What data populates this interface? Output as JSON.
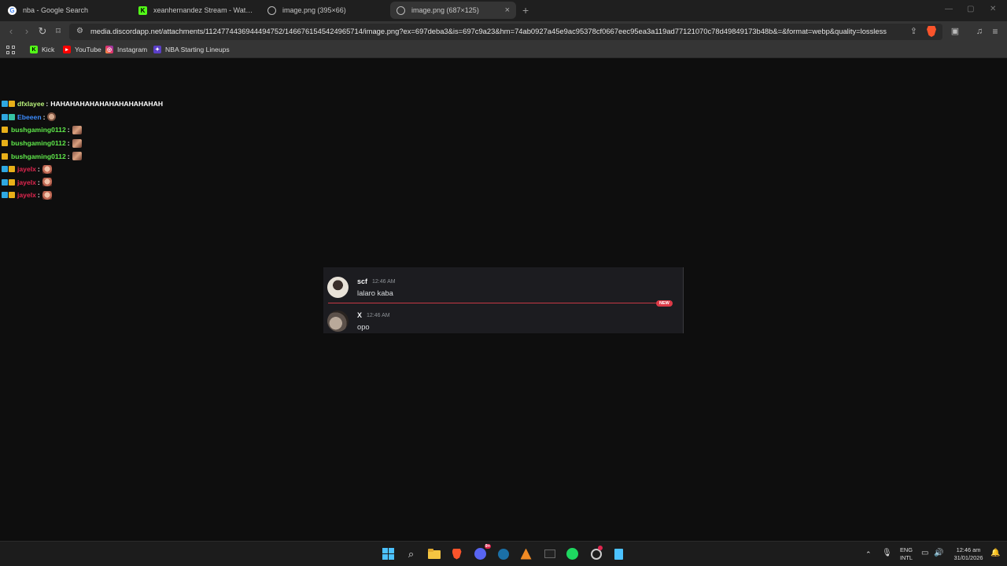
{
  "tabs": [
    {
      "title": "nba - Google Search",
      "icon": "google-icon",
      "color": "#ffffff"
    },
    {
      "title": "xeanhernandez Stream - Watch Live",
      "icon": "kick-icon",
      "color": "#53fc18"
    },
    {
      "title": "image.png (395×66)",
      "icon": "globe-icon",
      "color": "#bbbbbb"
    },
    {
      "title": "image.png (687×125)",
      "icon": "globe-icon",
      "color": "#bbbbbb",
      "active": true
    }
  ],
  "address_bar": {
    "url": "media.discordapp.net/attachments/1124774436944494752/1466761545424965714/image.png?ex=697deba3&is=697c9a23&hm=74ab0927a45e9ac95378cf0667eec95ea3a119ad77121070c78d49849173b48b&=&format=webp&quality=lossless"
  },
  "bookmarks": [
    {
      "label": "Kick",
      "icon": "kick-icon",
      "color": "#53fc18"
    },
    {
      "label": "YouTube",
      "icon": "youtube-icon",
      "color": "#ff0000"
    },
    {
      "label": "Instagram",
      "icon": "instagram-icon",
      "color": "#e1306c"
    },
    {
      "label": "NBA Starting Lineups",
      "icon": "nba-icon",
      "color": "#5b3fc8"
    }
  ],
  "chat": [
    {
      "user": "dfxlayee",
      "color": "#b9f27b",
      "message": "HAHAHAHAHAHAHAHAHAHAHAH",
      "badges": [
        "b-blue",
        "b-yellow"
      ]
    },
    {
      "user": "Ebeeen",
      "color": "#3b8cff",
      "message": "",
      "emote": "emote-c",
      "badges": [
        "b-blue",
        "b-teal"
      ]
    },
    {
      "user": "bushgaming0112",
      "color": "#5fe84a",
      "message": "",
      "emote": "emote-a",
      "badges": [
        "b-yellow"
      ]
    },
    {
      "user": "bushgaming0112",
      "color": "#5fe84a",
      "message": "",
      "emote": "emote-a",
      "badges": [
        "b-yellow"
      ]
    },
    {
      "user": "bushgaming0112",
      "color": "#5fe84a",
      "message": "",
      "emote": "emote-a",
      "badges": [
        "b-yellow"
      ]
    },
    {
      "user": "jayelx",
      "color": "#e0264f",
      "message": "",
      "emote": "emote-b",
      "badges": [
        "b-blue",
        "b-yellow"
      ]
    },
    {
      "user": "jayelx",
      "color": "#e0264f",
      "message": "",
      "emote": "emote-b",
      "badges": [
        "b-blue",
        "b-yellow"
      ]
    },
    {
      "user": "jayelx",
      "color": "#e0264f",
      "message": "",
      "emote": "emote-b",
      "badges": [
        "b-blue",
        "b-yellow"
      ]
    }
  ],
  "discord": {
    "messages": [
      {
        "author": "scf",
        "time": "12:46 AM",
        "content": "lalaro kaba"
      },
      {
        "author": "X",
        "time": "12:46 AM",
        "content": "opo"
      }
    ],
    "new_label": "NEW",
    "divider_color": "#c73844"
  },
  "taskbar": {
    "apps": [
      "windows-start-icon",
      "search-icon",
      "file-explorer-icon",
      "brave-icon",
      "discord-icon",
      "steam-icon",
      "app-icon",
      "terminal-icon",
      "spotify-icon",
      "app-icon",
      "notepad-icon"
    ],
    "discord_badge": "9+",
    "language": "ENG",
    "layout": "INTL",
    "time": "12:46 am",
    "date": "31/01/2026"
  }
}
